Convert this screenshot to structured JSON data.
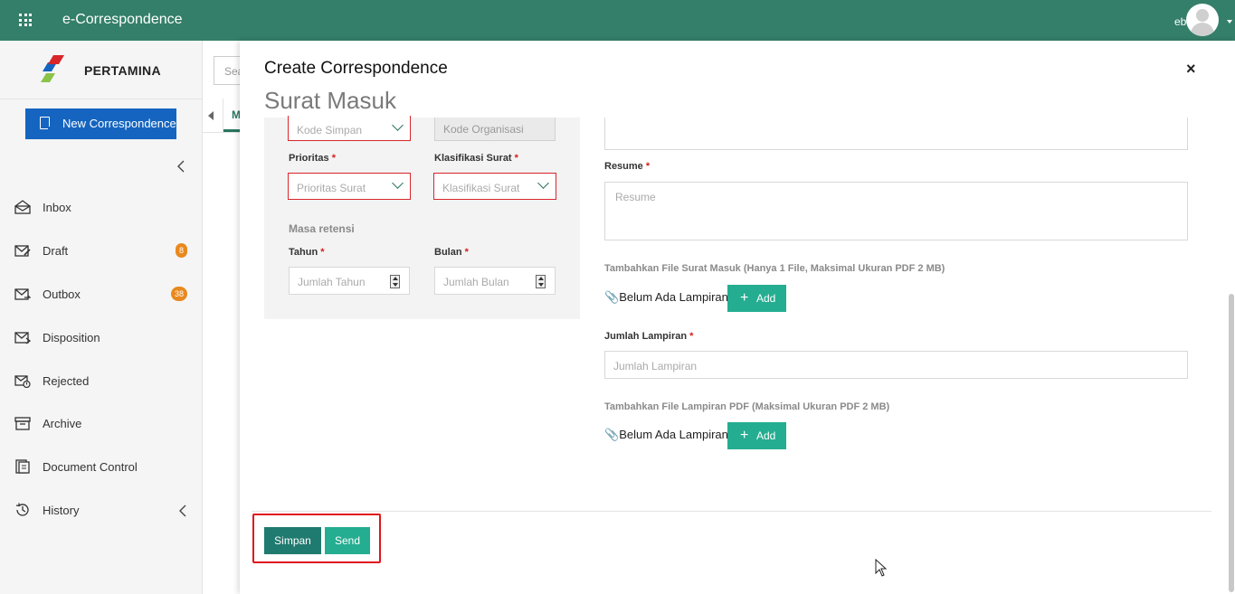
{
  "app": {
    "title": "e-Correspondence",
    "user": "ebi"
  },
  "sidebar": {
    "brand": "PERTAMINA",
    "new_button": "New Correspondence",
    "items": [
      {
        "label": "Inbox",
        "icon": "envelope-open-icon"
      },
      {
        "label": "Draft",
        "icon": "envelope-edit-icon",
        "badge": "8"
      },
      {
        "label": "Outbox",
        "icon": "envelope-send-icon",
        "badge": "38"
      },
      {
        "label": "Disposition",
        "icon": "envelope-forward-icon"
      },
      {
        "label": "Rejected",
        "icon": "envelope-rejected-icon"
      },
      {
        "label": "Archive",
        "icon": "archive-icon"
      },
      {
        "label": "Document Control",
        "icon": "document-control-icon"
      },
      {
        "label": "History",
        "icon": "history-icon"
      }
    ],
    "badge_color": "#e8891f"
  },
  "background": {
    "search_placeholder": "Sea",
    "tab_label": "M"
  },
  "modal": {
    "title": "Create Correspondence",
    "subtitle": "Surat Masuk",
    "close": "×",
    "left": {
      "kode_simpan_placeholder": "Kode Simpan",
      "kode_organisasi_placeholder": "Kode Organisasi",
      "prioritas_label": "Prioritas",
      "prioritas_placeholder": "Prioritas Surat",
      "klasifikasi_label": "Klasifikasi Surat",
      "klasifikasi_placeholder": "Klasifikasi Surat",
      "masa_retensi_label": "Masa retensi",
      "tahun_label": "Tahun",
      "tahun_placeholder": "Jumlah Tahun",
      "bulan_label": "Bulan",
      "bulan_placeholder": "Jumlah Bulan",
      "required_mark": "*"
    },
    "right": {
      "resume_label": "Resume",
      "resume_placeholder": "Resume",
      "file_surat_note": "Tambahkan File Surat Masuk (Hanya 1 File, Maksimal Ukuran PDF 2 MB)",
      "no_attachment_1": "Belum Ada Lampiran -",
      "add_label": "Add",
      "jumlah_lampiran_label": "Jumlah Lampiran",
      "jumlah_lampiran_placeholder": "Jumlah Lampiran",
      "file_lampiran_note": "Tambahkan File Lampiran PDF (Maksimal Ukuran PDF 2 MB)",
      "no_attachment_2": "Belum Ada Lampiran -"
    },
    "footer": {
      "simpan": "Simpan",
      "send": "Send"
    }
  },
  "colors": {
    "topbar": "#347f69",
    "primary": "#1565c0",
    "accent": "#24ad90",
    "error": "#d9262b"
  }
}
